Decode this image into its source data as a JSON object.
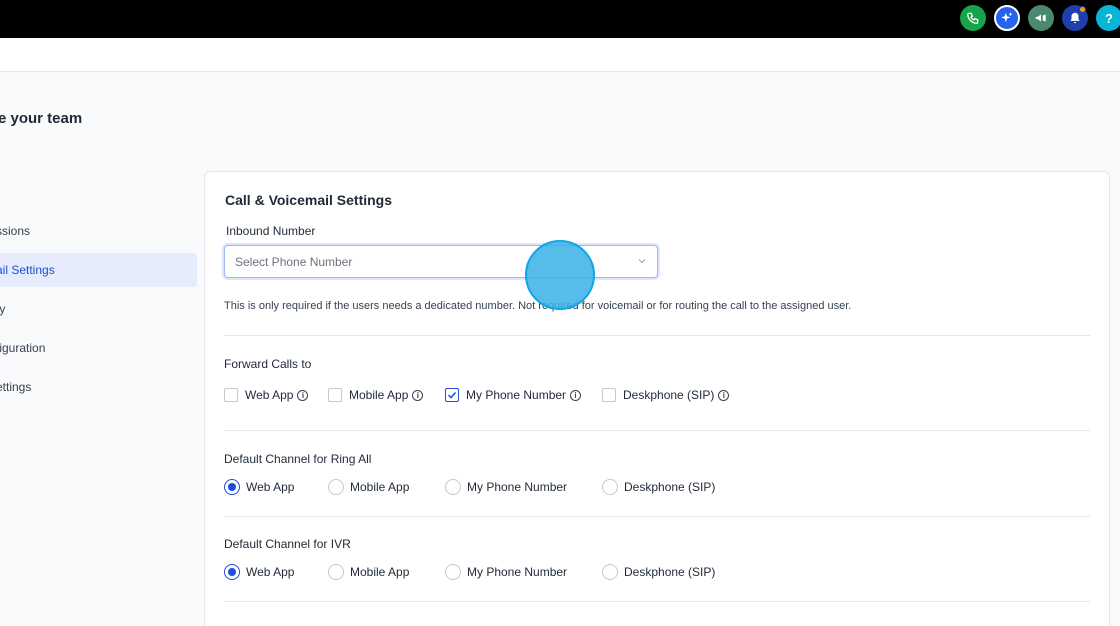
{
  "topbar": {
    "icons": [
      {
        "name": "phone-icon",
        "color": "#16a34a"
      },
      {
        "name": "sparkle-icon",
        "color": "#2563eb"
      },
      {
        "name": "megaphone-icon",
        "color": "#4b8a6e"
      },
      {
        "name": "bell-icon",
        "color": "#1e40af"
      },
      {
        "name": "help-icon",
        "color": "#06b6d4",
        "label": "?"
      }
    ]
  },
  "page": {
    "title": "e your team"
  },
  "sidenav": {
    "items": [
      {
        "label": "ssions",
        "active": false
      },
      {
        "label": "ail Settings",
        "active": true
      },
      {
        "label": "ty",
        "active": false
      },
      {
        "label": "figuration",
        "active": false
      },
      {
        "label": "ettings",
        "active": false
      }
    ]
  },
  "card": {
    "title": "Call & Voicemail Settings",
    "inbound": {
      "label": "Inbound Number",
      "placeholder": "Select Phone Number",
      "help": "This is only required if the users needs a dedicated number. Not required for voicemail or for routing the call to the assigned user."
    },
    "forward": {
      "label": "Forward Calls to",
      "options": [
        {
          "label": "Web App",
          "checked": false
        },
        {
          "label": "Mobile App",
          "checked": false
        },
        {
          "label": "My Phone Number",
          "checked": true
        },
        {
          "label": "Deskphone (SIP)",
          "checked": false
        }
      ]
    },
    "ring_all": {
      "label": "Default Channel for Ring All",
      "options": [
        {
          "label": "Web App",
          "checked": true
        },
        {
          "label": "Mobile App",
          "checked": false
        },
        {
          "label": "My Phone Number",
          "checked": false
        },
        {
          "label": "Deskphone (SIP)",
          "checked": false
        }
      ]
    },
    "ivr": {
      "label": "Default Channel for IVR",
      "options": [
        {
          "label": "Web App",
          "checked": true
        },
        {
          "label": "Mobile App",
          "checked": false
        },
        {
          "label": "My Phone Number",
          "checked": false
        },
        {
          "label": "Deskphone (SIP)",
          "checked": false
        }
      ]
    }
  }
}
